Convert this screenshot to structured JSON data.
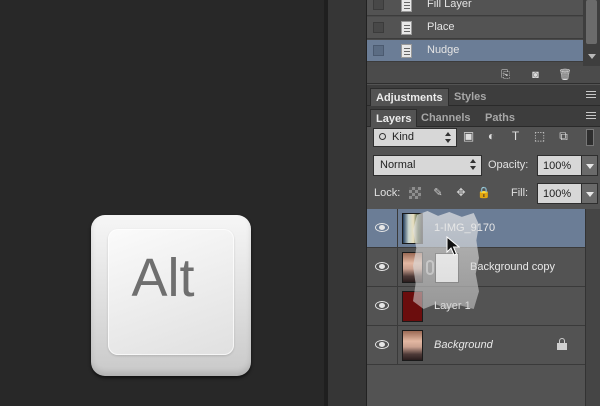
{
  "history": {
    "items": [
      {
        "label": "Fill Layer",
        "active": false
      },
      {
        "label": "Place",
        "active": false
      },
      {
        "label": "Nudge",
        "active": true
      }
    ]
  },
  "adjustments_panel": {
    "tabs": [
      {
        "label": "Adjustments",
        "active": true
      },
      {
        "label": "Styles",
        "active": false
      }
    ]
  },
  "layers_panel": {
    "tabs": [
      {
        "label": "Layers",
        "active": true
      },
      {
        "label": "Channels",
        "active": false
      },
      {
        "label": "Paths",
        "active": false
      }
    ],
    "filter_kind": "Kind",
    "blend_mode": "Normal",
    "opacity_label": "Opacity:",
    "opacity_value": "100%",
    "lock_label": "Lock:",
    "fill_label": "Fill:",
    "fill_value": "100%",
    "layers": [
      {
        "name": "1-IMG_9170",
        "active": true,
        "italic": false,
        "thumb": "busy",
        "mask": false,
        "locked": false
      },
      {
        "name": "Background copy",
        "active": false,
        "italic": false,
        "thumb": "photo",
        "mask": true,
        "locked": false
      },
      {
        "name": "Layer 1",
        "active": false,
        "italic": false,
        "thumb": "red",
        "mask": false,
        "locked": false
      },
      {
        "name": "Background",
        "active": false,
        "italic": true,
        "thumb": "photo",
        "mask": false,
        "locked": true
      }
    ]
  },
  "canvas": {
    "key_label": "Alt"
  },
  "colors": {
    "selection": "#6b7d96",
    "panel_bg": "#535353",
    "canvas_bg": "#282828"
  }
}
